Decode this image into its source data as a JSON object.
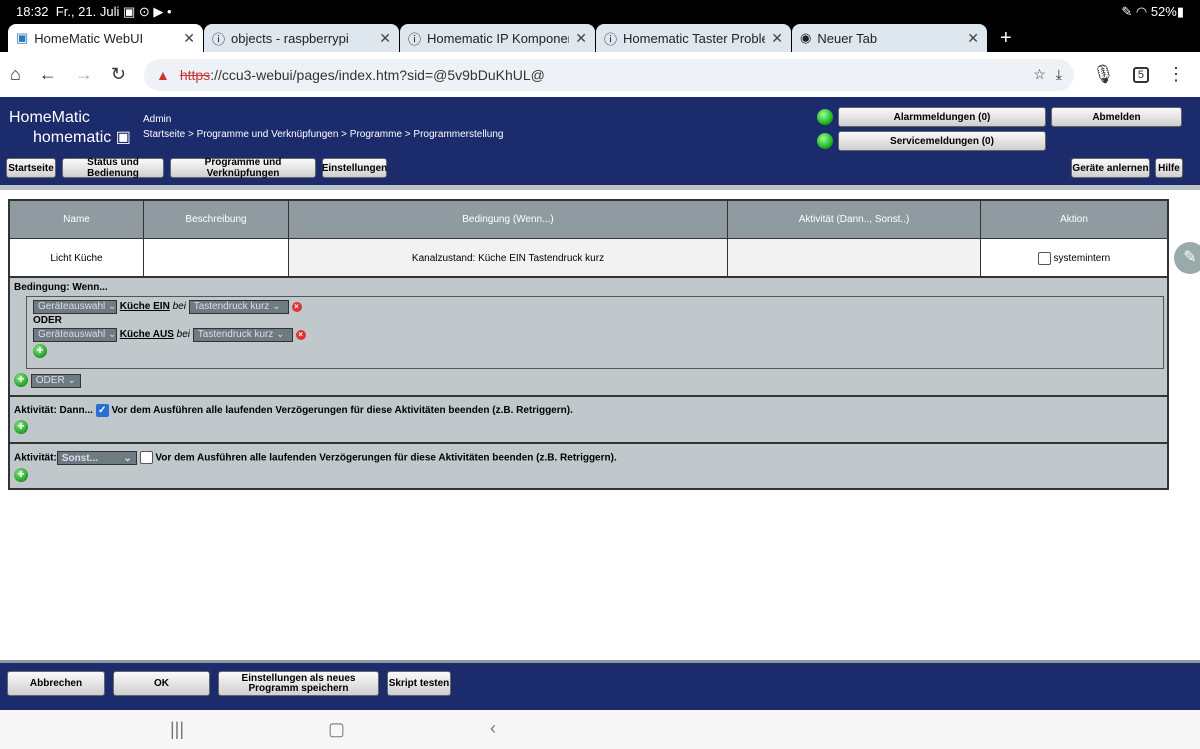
{
  "status": {
    "time": "18:32",
    "date": "Fr., 21. Juli",
    "battery": "52%"
  },
  "tabs": [
    {
      "label": "HomeMatic WebUI",
      "active": true
    },
    {
      "label": "objects - raspberrypi"
    },
    {
      "label": "Homematic IP Komponenten"
    },
    {
      "label": "Homematic Taster Problem"
    },
    {
      "label": "Neuer Tab"
    }
  ],
  "url": {
    "scheme": "https",
    "rest": "://ccu3-webui/pages/index.htm?sid=@5v9bDuKhUL@",
    "tab_count": "5"
  },
  "header": {
    "logo_top": "HomeMatic",
    "logo_bottom": "homematic",
    "user": "Admin",
    "breadcrumb": "Startseite > Programme und Verknüpfungen > Programme > Programmerstellung",
    "nav": [
      "Startseite",
      "Status und Bedienung",
      "Programme und Verknüpfungen",
      "Einstellungen"
    ],
    "alarm": "Alarmmeldungen (0)",
    "service": "Servicemeldungen (0)",
    "logout": "Abmelden",
    "teach": "Geräte anlernen",
    "help": "Hilfe"
  },
  "table": {
    "headers": [
      "Name",
      "Beschreibung",
      "Bedingung (Wenn...)",
      "Aktivität (Dann.., Sonst..)",
      "Aktion"
    ],
    "row": {
      "name": "Licht Küche",
      "description": "",
      "condition": "Kanalzustand: Küche EIN Tastendruck kurz",
      "activity": "",
      "action": "systemintern"
    }
  },
  "condition": {
    "title": "Bedingung: Wenn...",
    "rows": [
      {
        "device_select": "Geräteauswahl",
        "device": "Küche EIN",
        "bei": "bei",
        "trigger": "Tastendruck kurz"
      },
      {
        "device_select": "Geräteauswahl",
        "device": "Küche AUS",
        "bei": "bei",
        "trigger": "Tastendruck kurz"
      }
    ],
    "or": "ODER",
    "or_select": "ODER"
  },
  "then": {
    "title": "Aktivität: Dann...",
    "checked": true,
    "text": "Vor dem Ausführen alle laufenden Verzögerungen für diese Aktivitäten beenden (z.B. Retriggern)."
  },
  "else": {
    "title": "Aktivität:",
    "select": "Sonst...",
    "checked": false,
    "text": "Vor dem Ausführen alle laufenden Verzögerungen für diese Aktivitäten beenden (z.B. Retriggern)."
  },
  "footer": {
    "cancel": "Abbrechen",
    "ok": "OK",
    "save_new": "Einstellungen als neues Programm speichern",
    "test_script": "Skript testen"
  },
  "colors": {
    "header_blue": "#1c2b6c",
    "table_header": "#8f9ba1",
    "section_bg": "#c0c8cc"
  }
}
